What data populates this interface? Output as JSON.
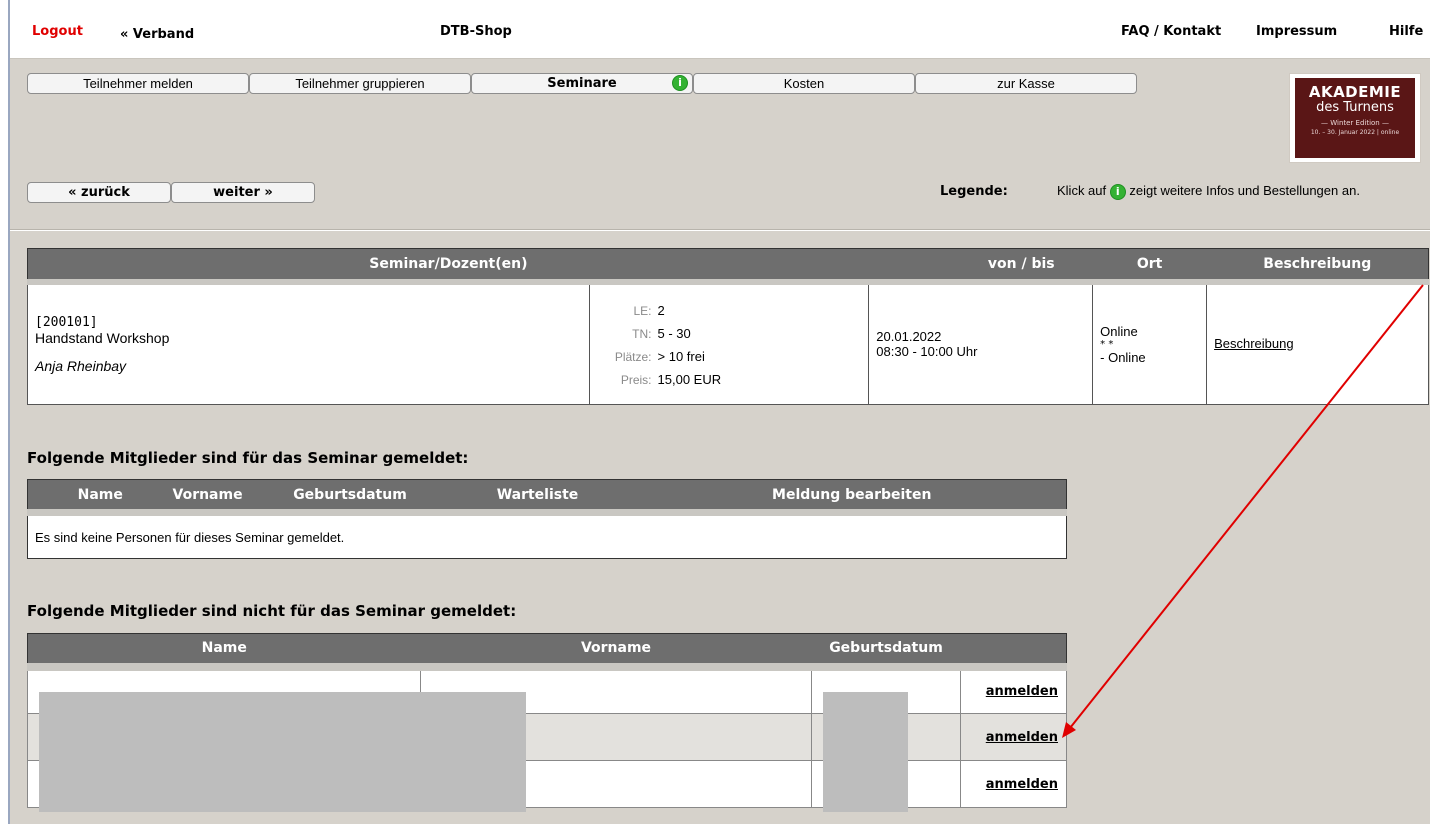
{
  "header": {
    "logout": "Logout",
    "verband": "« Verband",
    "title": "DTB-Shop",
    "faq": "FAQ / Kontakt",
    "impressum": "Impressum",
    "hilfe": "Hilfe"
  },
  "tabs": {
    "t1": "Teilnehmer melden",
    "t2": "Teilnehmer gruppieren",
    "t3": "Seminare",
    "t4": "Kosten",
    "t5": "zur Kasse"
  },
  "nav": {
    "back": "« zurück",
    "next": "weiter »"
  },
  "logo": {
    "line1": "AKADEMIE",
    "line2": "des Turnens",
    "line3": "— Winter Edition —",
    "line4": "10. – 30. Januar 2022 | online"
  },
  "legend": {
    "label": "Legende:",
    "pre": "Klick auf",
    "post": "zeigt weitere Infos und Bestellungen an."
  },
  "seminar_table": {
    "headers": {
      "seminar": "Seminar/Dozent(en)",
      "date": "von / bis",
      "ort": "Ort",
      "beschreibung": "Beschreibung"
    },
    "row": {
      "id": "[200101]",
      "title": "Handstand Workshop",
      "dozent": "Anja Rheinbay",
      "le_label": "LE:",
      "le": "2",
      "tn_label": "TN:",
      "tn": "5 - 30",
      "plaetze_label": "Plätze:",
      "plaetze": "> 10 frei",
      "preis_label": "Preis:",
      "preis": "15,00 EUR",
      "date": "20.01.2022",
      "time": "08:30 - 10:00 Uhr",
      "ort1": "Online",
      "ort2": "* *",
      "ort3": "- Online",
      "beschreibung_link": "Beschreibung"
    }
  },
  "registered": {
    "heading": "Folgende Mitglieder sind für das Seminar gemeldet:",
    "headers": {
      "name": "Name",
      "vorname": "Vorname",
      "geburtsdatum": "Geburtsdatum",
      "warteliste": "Warteliste",
      "meldung": "Meldung bearbeiten"
    },
    "empty": "Es sind keine Personen für dieses Seminar gemeldet."
  },
  "unregistered": {
    "heading": "Folgende Mitglieder sind nicht für das Seminar gemeldet:",
    "headers": {
      "name": "Name",
      "vorname": "Vorname",
      "geburtsdatum": "Geburtsdatum"
    },
    "rows": [
      {
        "action": "anmelden"
      },
      {
        "action": "anmelden"
      },
      {
        "action": "anmelden"
      }
    ]
  },
  "colors": {
    "header_gray": "#6e6e6e",
    "panel": "#d6d2cb",
    "logout_red": "#e00000",
    "arrow_red": "#e00000",
    "info_green": "#34b233",
    "logo_bg": "#5a1616"
  }
}
